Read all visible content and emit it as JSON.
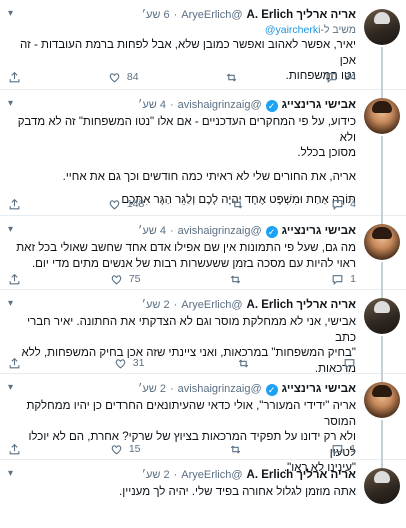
{
  "tweets": [
    {
      "author_name": "אריה ארליך A. Erlich",
      "handle": "@AryeErlich",
      "time": "6 שע׳",
      "avatar": "arie",
      "reply_prefix": "משיב ל-",
      "reply_link": "yaircherki@",
      "reply_suffix": "ול-",
      "lines": [
        "יאיר, אפשר לאהוב ואפשר כמובן שלא, אבל לפחות ברמת העובדות - זה אכן",
        "נטו המשפחות."
      ],
      "replies": "",
      "retweets": "",
      "likes": "84",
      "likes_liked": false,
      "share": "",
      "extra": "34"
    },
    {
      "author_name": "אבישי גרינצייג",
      "handle": "@avishaigrinzaig",
      "time": "4 שע׳",
      "avatar": "avishai",
      "verified": true,
      "lines": [
        "כידוע, על פי המחקרים העדכניים - אם אלו \"נטו המשפחות\" זה לא מדבק ולא",
        "מסוכן בכלל.",
        "",
        "אריה, את החורים שלי לא ראיתי כמה חודשים וכך גם את אחיי.",
        "",
        "תּוֹרָה אַחַת וּמִשְׁפָּט אֶחָד יִהְיֶה לָכֶם וְלַגֵּר הַגָּר אִתְּכֶם"
      ],
      "likes": "148",
      "extra": "4"
    },
    {
      "author_name": "אבישי גרינצייג",
      "handle": "@avishaigrinzaig",
      "time": "4 שע׳",
      "avatar": "avishai",
      "verified": true,
      "lines": [
        "מה גם, שעל פי התמונות אין שם אפילו אדם אחד שחשב שאולי בכל זאת",
        "ראוי להיות עם מסכה בזמן ששעשרות רבות של אנשים מתים מדי יום."
      ],
      "likes": "75",
      "extra": "1"
    },
    {
      "author_name": "אריה ארליך A. Erlich",
      "handle": "@AryeErlich",
      "time": "2 שע׳",
      "avatar": "arie",
      "lines": [
        "אבישי, אני לא ממחלקת מוסר וגם לא הצדקתי את החתונה. יאיר חברי כתב",
        "\"בחיק המשפחות\" במרכאות, ואני ציינתי שזה אכן בחיק המשפחות, ללא",
        "מרכאות."
      ],
      "likes": "31",
      "extra": ""
    },
    {
      "author_name": "אבישי גרינצייג",
      "handle": "@avishaigrinzaig",
      "time": "2 שע׳",
      "avatar": "avishai",
      "verified": true,
      "lines": [
        "אריה \"ידידי המעורר\", אולי כדאי שהעיתונאים החרדים כן יהיו ממחלקת המוסר",
        "ולא רק ידונו על תפקיד המרכאות בציוץ של שרקי? אחרת, הם לא יוכלו לטעון",
        "\"עינינו לא ראו\"."
      ],
      "likes": "15",
      "extra": "1"
    },
    {
      "author_name": "אריה ארליך A. Erlich",
      "handle": "@AryeErlich",
      "time": "2 שע׳",
      "avatar": "arie",
      "lines": [
        "אתה מוזמן לגלול אחורה בפיד שלי. יהיה לך מעניין."
      ],
      "likes": "",
      "extra": ""
    }
  ],
  "icons": {
    "reply": "reply-icon",
    "retweet": "retweet-icon",
    "like": "heart-icon",
    "share": "share-icon",
    "more": "chevron-down-icon"
  },
  "colors": {
    "accent": "#1da1f2",
    "muted": "#5b7083",
    "divider": "#e6ecf0"
  }
}
